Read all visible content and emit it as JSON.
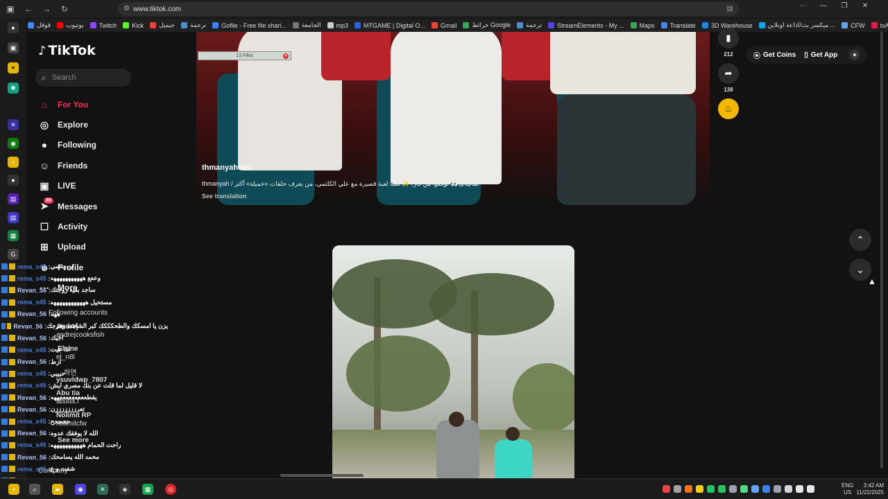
{
  "browser": {
    "url": "www.tiktok.com",
    "bookmarks": [
      {
        "label": "قوقل",
        "color": "#4285f4"
      },
      {
        "label": "يوتيوب",
        "color": "#ff0000"
      },
      {
        "label": "Twitch",
        "color": "#9146ff"
      },
      {
        "label": "Kick",
        "color": "#53fc18"
      },
      {
        "label": "جيميل",
        "color": "#ea4335"
      },
      {
        "label": "ترجمة",
        "color": "#4a90d9"
      },
      {
        "label": "Gofile - Free file shari...",
        "color": "#3b82f6"
      },
      {
        "label": "الجامعة",
        "color": "#777777"
      },
      {
        "label": "mp3",
        "color": "#cccccc"
      },
      {
        "label": "MTGAME | Digital O...",
        "color": "#2563eb"
      },
      {
        "label": "Gmail",
        "color": "#ea4335"
      },
      {
        "label": "خرائط Google",
        "color": "#34a853"
      },
      {
        "label": "ترجمة",
        "color": "#4a90d9"
      },
      {
        "label": "StreamElements - My ...",
        "color": "#4f46e5"
      },
      {
        "label": "Maps",
        "color": "#34a853"
      },
      {
        "label": "Translate",
        "color": "#4285f4"
      },
      {
        "label": "3D Warehouse",
        "color": "#1e88e5"
      },
      {
        "label": "ميكسر بث/اذاعة اونلاين ...",
        "color": "#0ea5e9"
      },
      {
        "label": "CFW",
        "color": "#60a5fa"
      },
      {
        "label": "txAdmin",
        "color": "#e11d48"
      }
    ]
  },
  "tiktok": {
    "logo": "TikTok",
    "search_placeholder": "Search",
    "nav": [
      {
        "label": "For You",
        "icon": "home-icon",
        "glyph": "⌂"
      },
      {
        "label": "Explore",
        "icon": "compass-icon",
        "glyph": "◎"
      },
      {
        "label": "Following",
        "icon": "avatar-icon",
        "glyph": "●"
      },
      {
        "label": "Friends",
        "icon": "friends-icon",
        "glyph": "☺"
      },
      {
        "label": "LIVE",
        "icon": "live-icon",
        "glyph": "▣"
      },
      {
        "label": "Messages",
        "icon": "send-icon",
        "glyph": "➤",
        "badge": "89"
      },
      {
        "label": "Activity",
        "icon": "activity-icon",
        "glyph": "☐"
      },
      {
        "label": "Upload",
        "icon": "upload-icon",
        "glyph": "⊞"
      },
      {
        "label": "Profile",
        "icon": "profile-icon",
        "glyph": "☻"
      },
      {
        "label": "More",
        "icon": "more-icon",
        "glyph": "⋯"
      }
    ],
    "sidebar_ghost": {
      "following_accounts": "Following accounts",
      "accounts": [
        "Andrej",
        "andrejcooksfish",
        "Elaine",
        "el_n8l",
        "ysuvldwp_7807",
        "하연",
        "Abu tia",
        "abutia.f",
        "Nolimit RP",
        "nolimitcfw"
      ],
      "see_more": "See more",
      "company": "Company"
    }
  },
  "chat": [
    {
      "user": "rema_s45",
      "msg": "ر. يـ سي",
      "type": "rema"
    },
    {
      "user": "rema_s45",
      "msg": "وععع هههههههههههه",
      "type": "rema"
    },
    {
      "user": "Revan_56",
      "msg": "ساجد بقيه زوجتك",
      "type": "revan"
    },
    {
      "user": "rema_s45",
      "msg": "مستحيل ههههههههههههه",
      "type": "rema"
    },
    {
      "user": "Revan_56",
      "msg": "ههه",
      "type": "revan"
    },
    {
      "user": "Revan_56",
      "msg": "يزن يا امسكك والطحكككك كبر الشاشه وفرجك",
      "type": "revan"
    },
    {
      "user": "Revan_56",
      "msg": "اجيك",
      "type": "revan"
    },
    {
      "user": "rema_s45",
      "msg": "اذا جيت",
      "type": "rema"
    },
    {
      "user": "Revan_56",
      "msg": "ازط",
      "type": "revan"
    },
    {
      "user": "rema_s45",
      "msg": "حبيبي",
      "type": "rema"
    },
    {
      "user": "rema_s45",
      "msg": "لا قليل لما قلت عن بنك مصري ايش",
      "type": "rema"
    },
    {
      "user": "Revan_56",
      "msg": "يقطعععععععععههه",
      "type": "revan"
    },
    {
      "user": "Revan_56",
      "msg": "تعرزززززززن",
      "type": "revan"
    },
    {
      "user": "rema_s45",
      "msg": "ححححح",
      "type": "rema"
    },
    {
      "user": "Revan_56",
      "msg": "الله لا يوفقك عدوه",
      "type": "revan"
    },
    {
      "user": "rema_s45",
      "msg": "راحت الحمام هههههههههههه",
      "type": "rema"
    },
    {
      "user": "Revan_56",
      "msg": "محمد الله يسامحك",
      "type": "revan"
    },
    {
      "user": "rema_s45",
      "msg": "شفت و ع",
      "type": "rema"
    },
    {
      "user": "rema_s45",
      "msg": "",
      "type": "rema"
    },
    {
      "user": "Revan_56",
      "msg": "ليش كل المقطع",
      "type": "revan"
    }
  ],
  "video1": {
    "author": "thmanyahexit",
    "caption": "ثمانية@👀 توقعوا من فاز؟✨ لعبنا لعبة قصيرة مع علي الكلثمي، من يعرف حلقات «خميلة» أكثر / thmanyah",
    "see_translation": "See translation",
    "files_label": "13 Files"
  },
  "actions": [
    {
      "icon": "bookmark-icon",
      "glyph": "▮",
      "count": "212"
    },
    {
      "icon": "share-icon",
      "glyph": "➦",
      "count": "138"
    },
    {
      "icon": "gold-flame-icon",
      "glyph": "♨",
      "count": ""
    }
  ],
  "header_right": {
    "get_coins": "Get Coins",
    "get_app": "Get App"
  },
  "taskbar": {
    "lang_1": "ENG",
    "lang_2": "US",
    "time": "3:42 AM",
    "date": "11/22/2025"
  }
}
